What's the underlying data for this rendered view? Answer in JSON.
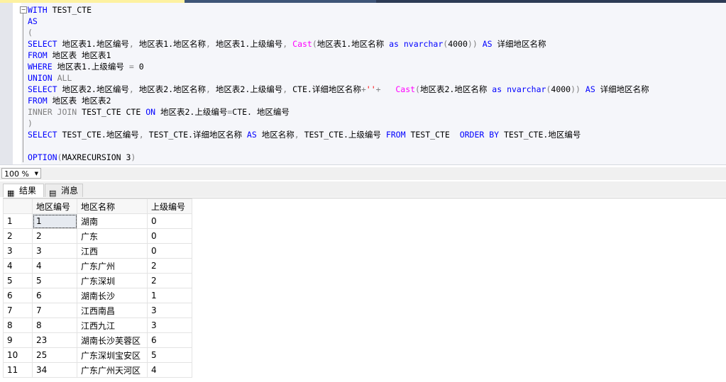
{
  "editor": {
    "lines": [
      [
        [
          "kw",
          "WITH"
        ],
        [
          "t",
          " TEST_CTE"
        ]
      ],
      [
        [
          "kw",
          "AS"
        ]
      ],
      [
        [
          "gr",
          "("
        ]
      ],
      [
        [
          "kw",
          "SELECT"
        ],
        [
          "t",
          " 地区表1.地区编号"
        ],
        [
          "gr",
          ","
        ],
        [
          "t",
          " 地区表1.地区名称"
        ],
        [
          "gr",
          ","
        ],
        [
          "t",
          " 地区表1.上级编号"
        ],
        [
          "gr",
          ","
        ],
        [
          "t",
          " "
        ],
        [
          "fn",
          "Cast"
        ],
        [
          "gr",
          "("
        ],
        [
          "t",
          "地区表1.地区名称 "
        ],
        [
          "kw",
          "as"
        ],
        [
          "t",
          " "
        ],
        [
          "kw",
          "nvarchar"
        ],
        [
          "gr",
          "("
        ],
        [
          "t",
          "4000"
        ],
        [
          "gr",
          "))"
        ],
        [
          "t",
          " "
        ],
        [
          "kw",
          "AS"
        ],
        [
          "t",
          " 详细地区名称"
        ]
      ],
      [
        [
          "kw",
          "FROM"
        ],
        [
          "t",
          " 地区表 地区表1"
        ]
      ],
      [
        [
          "kw",
          "WHERE"
        ],
        [
          "t",
          " 地区表1.上级编号 "
        ],
        [
          "gr",
          "="
        ],
        [
          "t",
          " 0"
        ]
      ],
      [
        [
          "kw",
          "UNION"
        ],
        [
          "t",
          " "
        ],
        [
          "gr",
          "ALL"
        ]
      ],
      [
        [
          "kw",
          "SELECT"
        ],
        [
          "t",
          " 地区表2.地区编号"
        ],
        [
          "gr",
          ","
        ],
        [
          "t",
          " 地区表2.地区名称"
        ],
        [
          "gr",
          ","
        ],
        [
          "t",
          " 地区表2.上级编号"
        ],
        [
          "gr",
          ","
        ],
        [
          "t",
          " CTE.详细地区名称"
        ],
        [
          "gr",
          "+"
        ],
        [
          "str",
          "''"
        ],
        [
          "gr",
          "+"
        ],
        [
          "t",
          "   "
        ],
        [
          "fn",
          "Cast"
        ],
        [
          "gr",
          "("
        ],
        [
          "t",
          "地区表2.地区名称 "
        ],
        [
          "kw",
          "as"
        ],
        [
          "t",
          " "
        ],
        [
          "kw",
          "nvarchar"
        ],
        [
          "gr",
          "("
        ],
        [
          "t",
          "4000"
        ],
        [
          "gr",
          "))"
        ],
        [
          "t",
          " "
        ],
        [
          "kw",
          "AS"
        ],
        [
          "t",
          " 详细地区名称"
        ]
      ],
      [
        [
          "kw",
          "FROM"
        ],
        [
          "t",
          " 地区表 地区表2"
        ]
      ],
      [
        [
          "gr",
          "INNER JOIN"
        ],
        [
          "t",
          " TEST_CTE CTE "
        ],
        [
          "kw",
          "ON"
        ],
        [
          "t",
          " 地区表2.上级编号"
        ],
        [
          "gr",
          "="
        ],
        [
          "t",
          "CTE. 地区编号"
        ]
      ],
      [
        [
          "gr",
          ")"
        ]
      ],
      [
        [
          "kw",
          "SELECT"
        ],
        [
          "t",
          " TEST_CTE.地区编号"
        ],
        [
          "gr",
          ","
        ],
        [
          "t",
          " TEST_CTE.详细地区名称 "
        ],
        [
          "kw",
          "AS"
        ],
        [
          "t",
          " 地区名称"
        ],
        [
          "gr",
          ","
        ],
        [
          "t",
          " TEST_CTE.上级编号 "
        ],
        [
          "kw",
          "FROM"
        ],
        [
          "t",
          " TEST_CTE  "
        ],
        [
          "kw",
          "ORDER BY"
        ],
        [
          "t",
          " TEST_CTE.地区编号"
        ]
      ],
      [],
      [
        [
          "kw",
          "OPTION"
        ],
        [
          "gr",
          "("
        ],
        [
          "t",
          "MAXRECURSION 3"
        ],
        [
          "gr",
          ")"
        ]
      ]
    ]
  },
  "zoom": {
    "value": "100 %"
  },
  "tabs": [
    {
      "label": "结果",
      "icon": "grid-icon"
    },
    {
      "label": "消息",
      "icon": "messages-icon"
    }
  ],
  "results": {
    "columns": [
      "地区编号",
      "地区名称",
      "上级编号"
    ],
    "rows": [
      [
        "1",
        "1",
        "湖南",
        "0"
      ],
      [
        "2",
        "2",
        "广东",
        "0"
      ],
      [
        "3",
        "3",
        "江西",
        "0"
      ],
      [
        "4",
        "4",
        "广东广州",
        "2"
      ],
      [
        "5",
        "5",
        "广东深圳",
        "2"
      ],
      [
        "6",
        "6",
        "湖南长沙",
        "1"
      ],
      [
        "7",
        "7",
        "江西南昌",
        "3"
      ],
      [
        "8",
        "8",
        "江西九江",
        "3"
      ],
      [
        "9",
        "23",
        "湖南长沙芙蓉区",
        "6"
      ],
      [
        "10",
        "25",
        "广东深圳宝安区",
        "5"
      ],
      [
        "11",
        "34",
        "广东广州天河区",
        "4"
      ]
    ]
  }
}
